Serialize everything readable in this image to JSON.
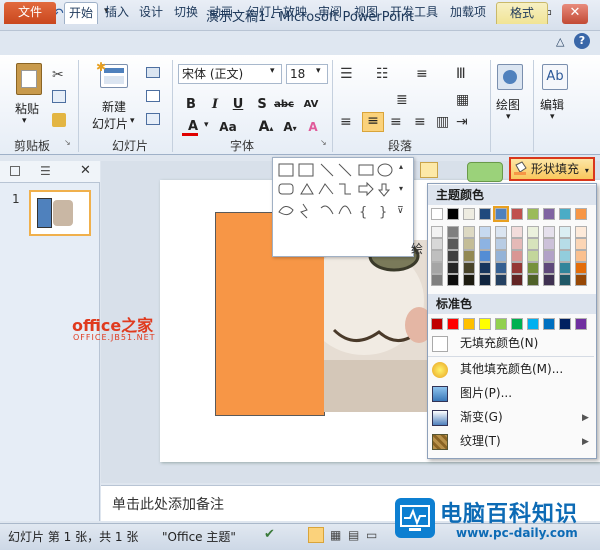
{
  "window": {
    "title": "演示文稿1 - Microsoft PowerPoint"
  },
  "tabs": {
    "file": "文件",
    "home": "开始",
    "insert": "插入",
    "design": "设计",
    "transitions": "切换",
    "animations": "动画",
    "slideshow": "幻灯片放映",
    "review": "审阅",
    "view": "视图",
    "developer": "开发工具",
    "addins": "加载项",
    "format": "格式"
  },
  "ribbon": {
    "paste": "粘贴",
    "clipboard_group": "剪贴板",
    "new_slide_line1": "新建",
    "new_slide_line2": "幻灯片",
    "slides_group": "幻灯片",
    "font_name": "宋体 (正文)",
    "font_size": "18",
    "font_group": "字体",
    "paragraph_group": "段落",
    "drawing": "绘图",
    "editing": "编辑",
    "drawing_group_partial": "绘"
  },
  "slide_pane": {
    "slide_number": "1"
  },
  "fill_menu": {
    "button_label": "形状填充",
    "theme_colors_heading": "主题颜色",
    "standard_colors_heading": "标准色",
    "no_fill": "无填充颜色(N)",
    "more_colors": "其他填充颜色(M)...",
    "picture": "图片(P)...",
    "gradient": "渐变(G)",
    "texture": "纹理(T)",
    "theme_top_row": [
      "#ffffff",
      "#000000",
      "#eeece1",
      "#1f497d",
      "#4f81bd",
      "#c0504d",
      "#9bbb59",
      "#8064a2",
      "#4bacc6",
      "#f79646"
    ],
    "theme_shades": [
      [
        "#f2f2f2",
        "#7f7f7f",
        "#ddd9c3",
        "#c6d9f0",
        "#dbe5f1",
        "#f2dcdb",
        "#ebf1dd",
        "#e5e0ec",
        "#dbeef3",
        "#fdeada"
      ],
      [
        "#d8d8d8",
        "#595959",
        "#c4bd97",
        "#8db3e2",
        "#b8cce4",
        "#e5b9b7",
        "#d7e3bc",
        "#ccc1d9",
        "#b7dde8",
        "#fbd5b5"
      ],
      [
        "#bfbfbf",
        "#3f3f3f",
        "#938953",
        "#548dd4",
        "#95b3d7",
        "#d99694",
        "#c3d69b",
        "#b2a2c7",
        "#92cddc",
        "#fac08f"
      ],
      [
        "#a5a5a5",
        "#262626",
        "#494429",
        "#17365d",
        "#366092",
        "#953734",
        "#76923c",
        "#5f497a",
        "#31859b",
        "#e36c09"
      ],
      [
        "#7f7f7f",
        "#0c0c0c",
        "#1d1b10",
        "#0f243e",
        "#244061",
        "#632423",
        "#4f6128",
        "#3f3151",
        "#205867",
        "#974806"
      ]
    ],
    "standard_colors": [
      "#c00000",
      "#ff0000",
      "#ffc000",
      "#ffff00",
      "#92d050",
      "#00b050",
      "#00b0f0",
      "#0070c0",
      "#002060",
      "#7030a0"
    ]
  },
  "slide": {
    "watermark_text": "office之家",
    "watermark_sub": "OFFICE.JB51.NET",
    "rect_color": "#f79646"
  },
  "notes": {
    "placeholder": "单击此处添加备注"
  },
  "status": {
    "slide_info": "幻灯片 第 1 张，共 1 张",
    "theme": "\"Office 主题\""
  },
  "site_watermark": {
    "name": "电脑百科知识",
    "url": "www.pc-daily.com"
  }
}
